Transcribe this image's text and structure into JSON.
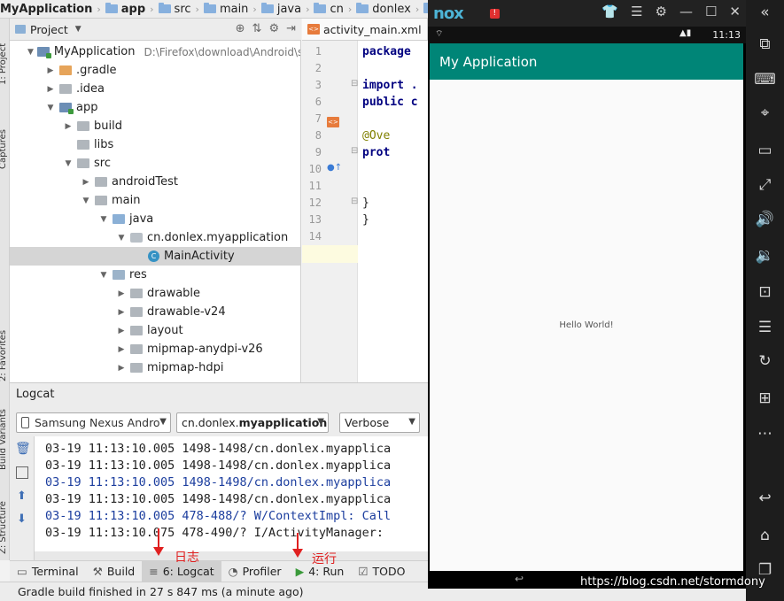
{
  "breadcrumb": [
    "MyApplication",
    "app",
    "src",
    "main",
    "java",
    "cn",
    "donlex",
    "m"
  ],
  "side_tabs": {
    "project": "1: Project",
    "captures": "Captures",
    "favorites": "2: Favorites",
    "build_variants": "Build Variants",
    "structure": "Z: Structure"
  },
  "project_panel": {
    "title": "Project"
  },
  "tree": [
    {
      "label": "MyApplication",
      "icon": "module",
      "arrow": "down",
      "path": "D:\\Firefox\\download\\Android\\stud",
      "depth": 0
    },
    {
      "label": ".gradle",
      "icon": "folder-orange",
      "arrow": "right",
      "depth": 1
    },
    {
      "label": ".idea",
      "icon": "folder-gray",
      "arrow": "right",
      "depth": 1
    },
    {
      "label": "app",
      "icon": "module",
      "arrow": "down",
      "depth": 1
    },
    {
      "label": "build",
      "icon": "folder-gray",
      "arrow": "right",
      "depth": 2
    },
    {
      "label": "libs",
      "icon": "folder-gray",
      "arrow": "",
      "depth": 2
    },
    {
      "label": "src",
      "icon": "folder-gray",
      "arrow": "down",
      "depth": 2
    },
    {
      "label": "androidTest",
      "icon": "folder-gray",
      "arrow": "right",
      "depth": 3
    },
    {
      "label": "main",
      "icon": "folder-gray",
      "arrow": "down",
      "depth": 3
    },
    {
      "label": "java",
      "icon": "folder-blue",
      "arrow": "down",
      "depth": 4
    },
    {
      "label": "cn.donlex.myapplication",
      "icon": "package",
      "arrow": "down",
      "depth": 5
    },
    {
      "label": "MainActivity",
      "icon": "class",
      "arrow": "",
      "depth": 6,
      "selected": true
    },
    {
      "label": "res",
      "icon": "folder-res",
      "arrow": "down",
      "depth": 4
    },
    {
      "label": "drawable",
      "icon": "folder-gray",
      "arrow": "right",
      "depth": 5
    },
    {
      "label": "drawable-v24",
      "icon": "folder-gray",
      "arrow": "right",
      "depth": 5
    },
    {
      "label": "layout",
      "icon": "folder-gray",
      "arrow": "right",
      "depth": 5
    },
    {
      "label": "mipmap-anydpi-v26",
      "icon": "folder-gray",
      "arrow": "right",
      "depth": 5
    },
    {
      "label": "mipmap-hdpi",
      "icon": "folder-gray",
      "arrow": "right",
      "depth": 5
    }
  ],
  "editor": {
    "tab_label": "activity_main.xml",
    "line_numbers": [
      "1",
      "2",
      "3",
      "6",
      "7",
      "8",
      "9",
      "10",
      "11",
      "12",
      "13",
      "14"
    ],
    "code_lines": [
      {
        "text": "package",
        "cls": "kw"
      },
      {
        "text": "",
        "cls": ""
      },
      {
        "text": "import .",
        "cls": "kw"
      },
      {
        "text": "public c",
        "cls": "kw"
      },
      {
        "text": "",
        "cls": ""
      },
      {
        "text": "    @Ove",
        "cls": "an"
      },
      {
        "text": "    prot",
        "cls": "kw"
      },
      {
        "text": "",
        "cls": ""
      },
      {
        "text": "",
        "cls": ""
      },
      {
        "text": "    }",
        "cls": ""
      },
      {
        "text": "}",
        "cls": ""
      },
      {
        "text": "",
        "cls": ""
      }
    ]
  },
  "logcat": {
    "title": "Logcat",
    "device": "Samsung Nexus Andro",
    "process_prefix": "cn.donlex.",
    "process_bold": "myapplication",
    "level": "Verbose",
    "lines": [
      {
        "text": "03-19 11:13:10.005 1498-1498/cn.donlex.myapplica",
        "blue": false
      },
      {
        "text": "03-19 11:13:10.005 1498-1498/cn.donlex.myapplica",
        "blue": false
      },
      {
        "text": "03-19 11:13:10.005 1498-1498/cn.donlex.myapplica",
        "blue": true
      },
      {
        "text": "03-19 11:13:10.005 1498-1498/cn.donlex.myapplica",
        "blue": false
      },
      {
        "text": "03-19 11:13:10.005 478-488/? W/ContextImpl: Call",
        "blue": true
      },
      {
        "text": "03-19 11:13:10.075 478-490/? I/ActivityManager: ",
        "blue": false
      }
    ]
  },
  "tool_tabs": [
    {
      "label": "Terminal",
      "icon": "terminal-icon",
      "glyph": "▭",
      "active": false
    },
    {
      "label": "Build",
      "icon": "build-icon",
      "glyph": "⚒",
      "active": false
    },
    {
      "label": "6: Logcat",
      "icon": "logcat-icon",
      "glyph": "≡",
      "active": true
    },
    {
      "label": "Profiler",
      "icon": "profiler-icon",
      "glyph": "◔",
      "active": false
    },
    {
      "label": "4: Run",
      "icon": "run-icon",
      "glyph": "▶",
      "active": false
    },
    {
      "label": "TODO",
      "icon": "todo-icon",
      "glyph": "☑",
      "active": false
    }
  ],
  "annotations": {
    "logcat_note": "日志",
    "run_note": "运行"
  },
  "status": {
    "text": "Gradle build finished in 27 s 847 ms (a minute ago)"
  },
  "emulator": {
    "logo": "nox",
    "time": "11:13",
    "app_title": "My Application",
    "content_text": "Hello World!",
    "accent": "#008577"
  },
  "right_toolbar": [
    {
      "name": "collapse-icon",
      "glyph": "«"
    },
    {
      "name": "rotate-icon",
      "glyph": "⧉"
    },
    {
      "name": "keyboard-icon",
      "glyph": "⌨"
    },
    {
      "name": "location-icon",
      "glyph": "⌖"
    },
    {
      "name": "screen-icon",
      "glyph": "▭"
    },
    {
      "name": "fullscreen-icon",
      "glyph": "⤢"
    },
    {
      "name": "volume-up-icon",
      "glyph": "🔊"
    },
    {
      "name": "volume-down-icon",
      "glyph": "🔉"
    },
    {
      "name": "screenshot-icon",
      "glyph": "⊡"
    },
    {
      "name": "multi-instance-icon",
      "glyph": "☰"
    },
    {
      "name": "macro-icon",
      "glyph": "↻"
    },
    {
      "name": "apk-install-icon",
      "glyph": "⊞"
    },
    {
      "name": "more-icon",
      "glyph": "⋯"
    },
    {
      "name": "back-icon",
      "glyph": "↩"
    },
    {
      "name": "home-icon",
      "glyph": "⌂"
    },
    {
      "name": "recent-apps-icon",
      "glyph": "❐"
    }
  ],
  "watermark": "https://blog.csdn.net/stormdony"
}
